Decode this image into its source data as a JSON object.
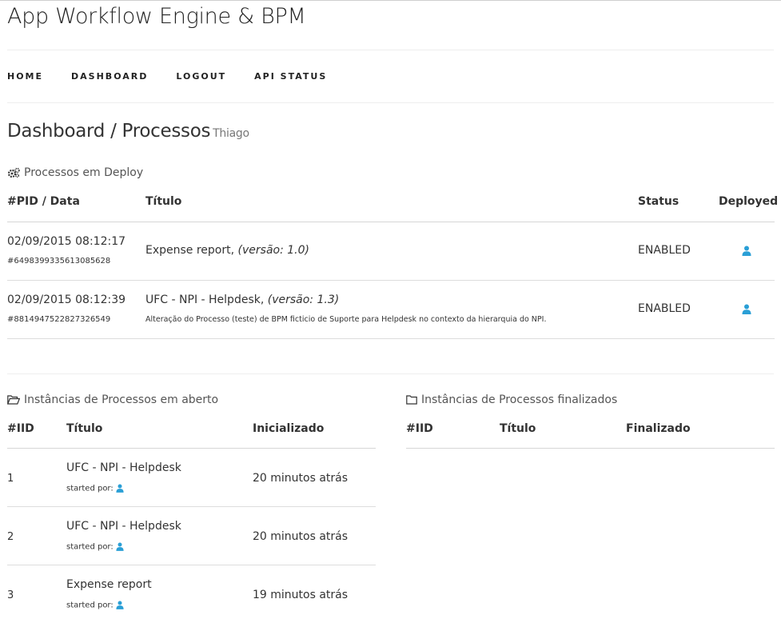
{
  "app": {
    "title": "App Workflow Engine & BPM"
  },
  "nav": [
    {
      "label": "HOME"
    },
    {
      "label": "DASHBOARD"
    },
    {
      "label": "LOGOUT"
    },
    {
      "label": "API STATUS"
    }
  ],
  "page": {
    "title": "Dashboard / Processos",
    "user": "Thiago"
  },
  "deploy": {
    "section_title": "Processos em Deploy",
    "icon": "gears-icon",
    "headers": {
      "pid": "#PID / Data",
      "title": "Título",
      "status": "Status",
      "deployed": "Deployed"
    },
    "rows": [
      {
        "date": "02/09/2015 08:12:17",
        "pid": "#6498399335613085628",
        "title": "Expense report,",
        "version": "(versão: 1.0)",
        "description": "",
        "status": "ENABLED",
        "deployed_icon": "user-icon"
      },
      {
        "date": "02/09/2015 08:12:39",
        "pid": "#8814947522827326549",
        "title": "UFC - NPI - Helpdesk,",
        "version": "(versão: 1.3)",
        "description": "Alteração do Processo (teste) de BPM ficticio de Suporte para Helpdesk no contexto da hierarquia do NPI.",
        "status": "ENABLED",
        "deployed_icon": "user-icon"
      }
    ]
  },
  "open_instances": {
    "section_title": "Instâncias de Processos em aberto",
    "icon": "folder-open-icon",
    "headers": {
      "iid": "#IID",
      "title": "Título",
      "started": "Inicializado"
    },
    "rows": [
      {
        "iid": "1",
        "title": "UFC - NPI - Helpdesk",
        "started_by": "started por:",
        "started": "20 minutos atrás"
      },
      {
        "iid": "2",
        "title": "UFC - NPI - Helpdesk",
        "started_by": "started por:",
        "started": "20 minutos atrás"
      },
      {
        "iid": "3",
        "title": "Expense report",
        "started_by": "started por:",
        "started": "19 minutos atrás"
      }
    ]
  },
  "finished_instances": {
    "section_title": "Instâncias de Processos finalizados",
    "icon": "folder-icon",
    "headers": {
      "iid": "#IID",
      "title": "Título",
      "finished": "Finalizado"
    }
  },
  "colors": {
    "accent": "#2a9fd6",
    "text": "#333333",
    "border": "#dddddd"
  }
}
